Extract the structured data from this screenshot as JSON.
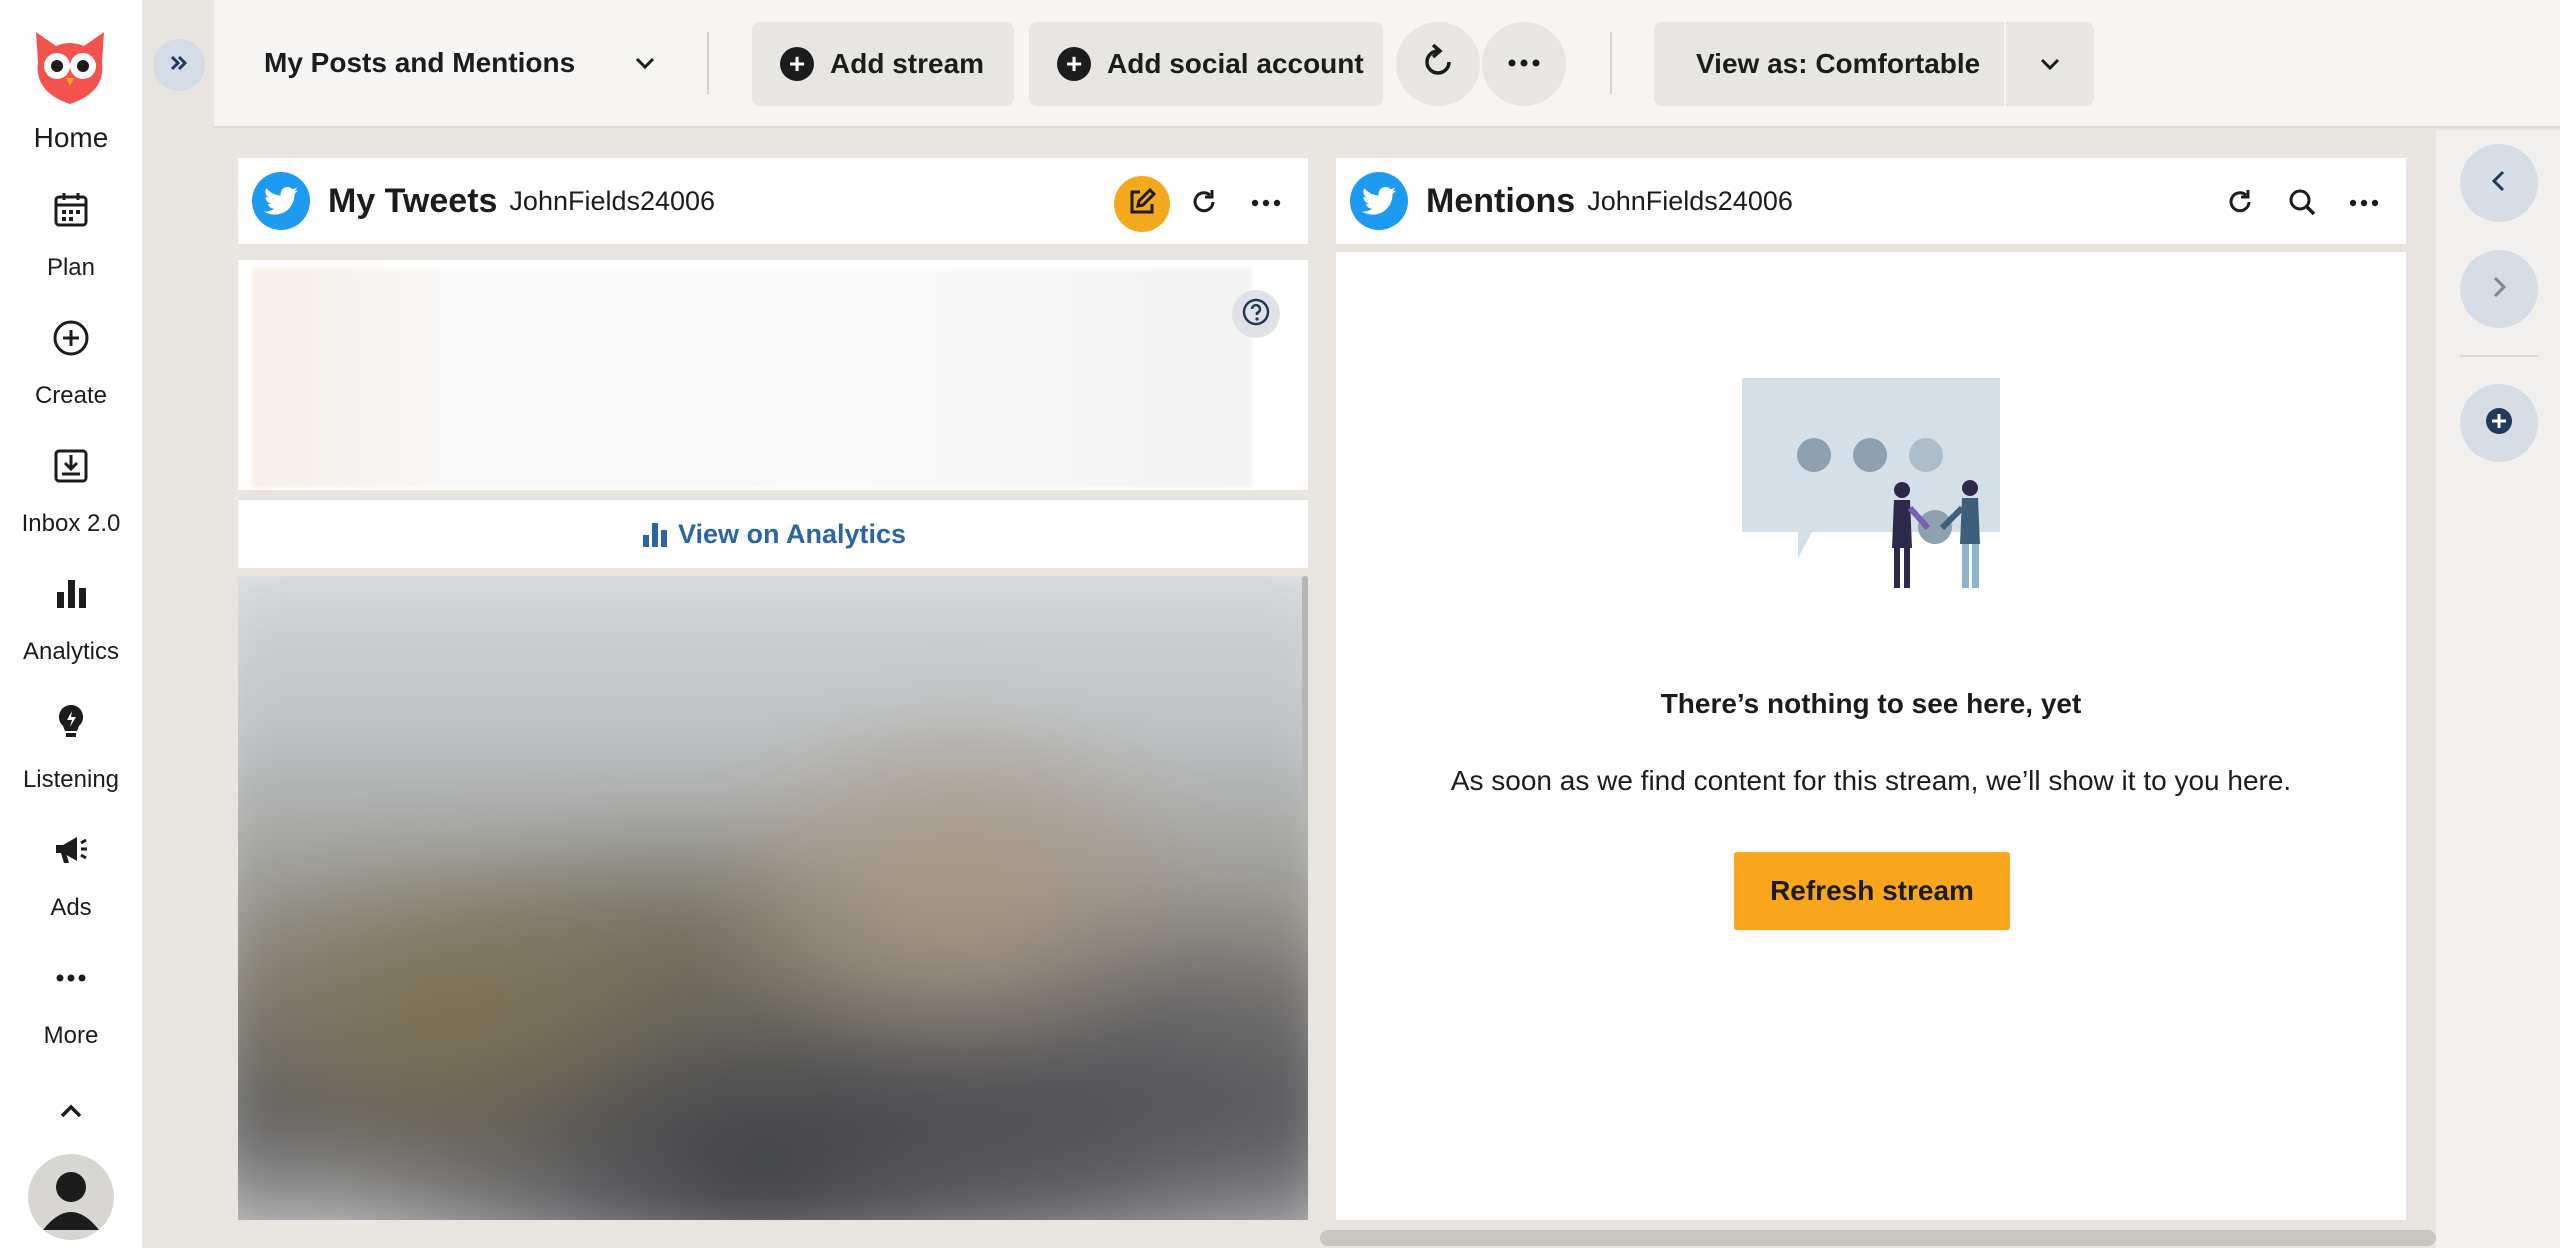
{
  "nav": {
    "home": "Home",
    "items": [
      {
        "label": "Plan",
        "icon": "calendar-icon"
      },
      {
        "label": "Create",
        "icon": "plus-circle-icon"
      },
      {
        "label": "Inbox 2.0",
        "icon": "inbox-icon"
      },
      {
        "label": "Analytics",
        "icon": "bar-chart-icon"
      },
      {
        "label": "Listening",
        "icon": "lightbulb-icon"
      },
      {
        "label": "Ads",
        "icon": "megaphone-icon"
      },
      {
        "label": "More",
        "icon": "ellipsis-icon"
      }
    ]
  },
  "toolbar": {
    "tab_selector": "My Posts and Mentions",
    "add_stream": "Add stream",
    "add_social_account": "Add social account",
    "view_as": "View as: Comfortable"
  },
  "streams": [
    {
      "title": "My Tweets",
      "user": "JohnFields24006",
      "analytics_link": "View on Analytics"
    },
    {
      "title": "Mentions",
      "user": "JohnFields24006",
      "empty_title": "There’s nothing to see here, yet",
      "empty_subtitle": "As soon as we find content for this stream, we’ll show it to you here.",
      "refresh_button": "Refresh stream"
    }
  ],
  "colors": {
    "accent": "#f9a61c",
    "twitter": "#1d9bf0",
    "link": "#2966a3",
    "brand_owl": "#f4524d"
  }
}
